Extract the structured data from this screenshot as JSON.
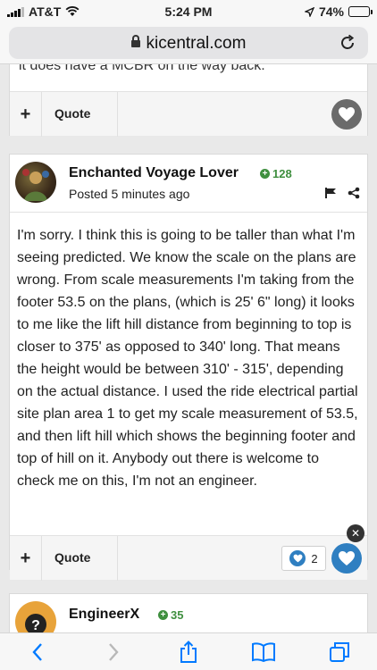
{
  "status_bar": {
    "carrier": "AT&T",
    "time": "5:24 PM",
    "battery_text": "74%",
    "battery_level": 0.74
  },
  "browser": {
    "url": "kicentral.com"
  },
  "previous_post": {
    "partial_text": "it does have a MCBR on the way back.",
    "plus_label": "+",
    "quote_label": "Quote"
  },
  "post": {
    "author": "Enchanted Voyage Lover",
    "reputation": "128",
    "posted": "Posted 5 minutes ago",
    "body": "I'm sorry. I think this is going to be taller than what I'm seeing predicted. We know the scale on the plans are wrong. From scale measurements I'm taking from the footer 53.5 on the plans, (which is 25' 6\" long) it looks to me like the lift hill distance from beginning to top is closer to 375' as opposed to 340' long. That means the height would be between 310' - 315', depending on the actual distance. I used the ride electrical partial site plan area 1 to get my scale measurement of 53.5, and then lift hill which shows the beginning footer and top of hill on it. Anybody out there is welcome to check me on this, I'm not an engineer.",
    "plus_label": "+",
    "quote_label": "Quote",
    "reaction_count": "2"
  },
  "next_post": {
    "author": "EngineerX",
    "reputation": "35"
  },
  "colors": {
    "like_active": "#2f7fc1",
    "like_inactive": "#6b6b6b",
    "reputation": "#3f8f3f",
    "ios_blue": "#007aff"
  }
}
